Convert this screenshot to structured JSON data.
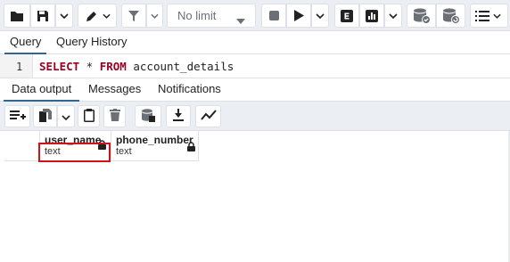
{
  "toolbar": {
    "limit_value": "No limit",
    "icons": [
      "folder-icon",
      "save-icon",
      "chevron-down-icon",
      "pen-icon",
      "chevron-down-icon",
      "filter-icon",
      "chevron-down-icon",
      "stop-icon",
      "play-icon",
      "chevron-down-icon",
      "explain-icon",
      "explain-analyze-icon",
      "chevron-down-icon",
      "commit-icon",
      "rollback-icon",
      "macros-icon",
      "chevron-down-icon"
    ]
  },
  "query_tabs": [
    "Query",
    "Query History"
  ],
  "editor": {
    "line_number": "1",
    "kw_select": "SELECT",
    "star": " * ",
    "kw_from": "FROM",
    "table": " account_details"
  },
  "output_tabs": [
    "Data output",
    "Messages",
    "Notifications"
  ],
  "data_toolbar": {
    "icons": [
      "add-row-icon",
      "copy-icon",
      "chevron-down-icon",
      "paste-icon",
      "delete-icon",
      "save-data-icon",
      "download-icon",
      "graph-icon"
    ]
  },
  "grid": {
    "columns": [
      {
        "name": "user_name",
        "type": "text"
      },
      {
        "name": "phone_number",
        "type": "text"
      }
    ]
  },
  "colors": {
    "toolbar_bg": "#ebeef3",
    "active_tab": "#326690",
    "keyword": "#9b0020",
    "highlight": "#d0121b"
  }
}
